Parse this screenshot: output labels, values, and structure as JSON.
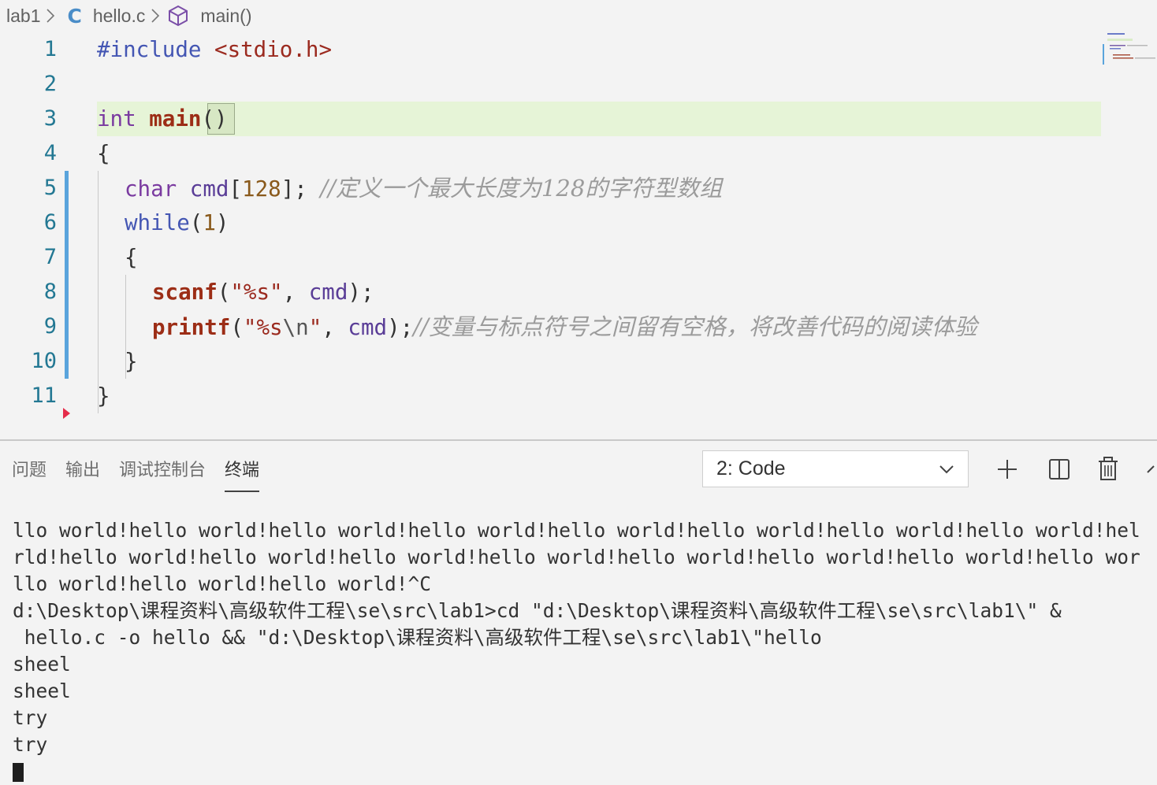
{
  "breadcrumb": {
    "folder": "lab1",
    "file_icon": "C",
    "file": "hello.c",
    "symbol": "main()"
  },
  "editor": {
    "line_numbers": [
      "1",
      "2",
      "3",
      "4",
      "5",
      "6",
      "7",
      "8",
      "9",
      "10",
      "11"
    ],
    "lines": {
      "l1": {
        "include": "#include",
        "header": "<stdio.h>"
      },
      "l3": {
        "type": "int",
        "name": "main",
        "parens": "()"
      },
      "l4": {
        "brace": "{"
      },
      "l5": {
        "type": "char",
        "ident": "cmd",
        "open": "[",
        "num": "128",
        "close": "];",
        "comment": "//定义一个最大长度为128的字符型数组"
      },
      "l6": {
        "kw": "while",
        "open": "(",
        "num": "1",
        "close": ")"
      },
      "l7": {
        "brace": "{"
      },
      "l8": {
        "fn": "scanf",
        "open": "(",
        "str": "\"%s\"",
        "comma": ", ",
        "ident": "cmd",
        "close": ");"
      },
      "l9": {
        "fn": "printf",
        "open": "(",
        "str1": "\"%s",
        "esc": "\\n",
        "str2": "\"",
        "comma": ", ",
        "ident": "cmd",
        "close": ");",
        "comment": "//变量与标点符号之间留有空格，将改善代码的阅读体验"
      },
      "l10": {
        "brace": "}"
      },
      "l11": {
        "brace": "}"
      }
    }
  },
  "panel": {
    "tabs": [
      "问题",
      "输出",
      "调试控制台",
      "终端"
    ],
    "active_tab": "终端",
    "terminal_select": "2: Code"
  },
  "terminal": {
    "lines": [
      "llo world!hello world!hello world!hello world!hello world!hello world!hello world!hello world!hel",
      "rld!hello world!hello world!hello world!hello world!hello world!hello world!hello world!hello wor",
      "llo world!hello world!hello world!^C",
      "d:\\Desktop\\课程资料\\高级软件工程\\se\\src\\lab1>cd \"d:\\Desktop\\课程资料\\高级软件工程\\se\\src\\lab1\\\" &",
      " hello.c -o hello && \"d:\\Desktop\\课程资料\\高级软件工程\\se\\src\\lab1\\\"hello",
      "sheel",
      "sheel",
      "try",
      "try"
    ]
  },
  "colors": {
    "line_highlight": "#e6f4d7",
    "git_modified_bar": "#5aa4dc",
    "keyword_blue": "#4456b3",
    "function_red": "#9c2d16",
    "comment_gray": "#9b9b9b"
  }
}
